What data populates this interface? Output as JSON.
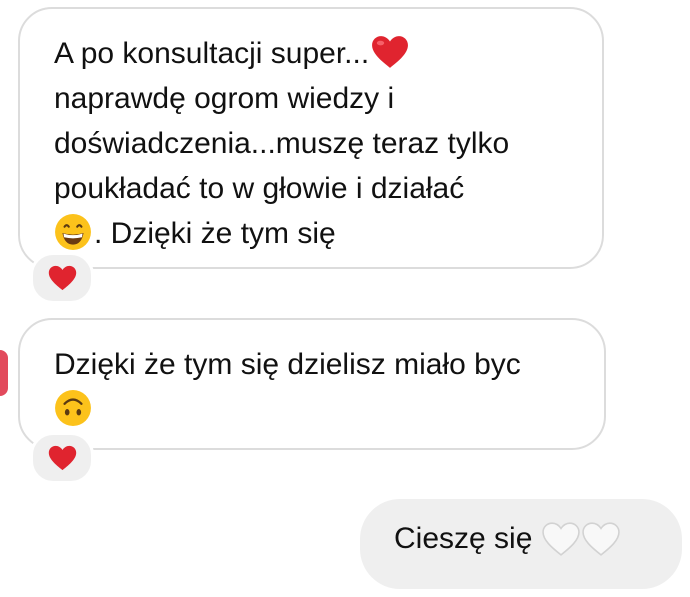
{
  "messages": [
    {
      "direction": "incoming",
      "lines": [
        "A po konsultacji super...",
        "naprawdę ogrom wiedzy i",
        "doświadczenia...muszę teraz tylko",
        "poukładać to w głowie i działać",
        ". Dzięki że tym się"
      ],
      "emojis": [
        "red-heart",
        "grinning-face"
      ],
      "reaction": "red-heart"
    },
    {
      "direction": "incoming",
      "lines": [
        "Dzięki że tym się dzielisz miało byc"
      ],
      "emojis": [
        "upside-down-face"
      ],
      "reaction": "red-heart"
    },
    {
      "direction": "outgoing",
      "text": "Cieszę się",
      "emojis": [
        "white-heart",
        "white-heart"
      ]
    }
  ],
  "colors": {
    "incoming_bubble_bg": "#ffffff",
    "incoming_bubble_border": "#dcdcdc",
    "outgoing_bubble_bg": "#efefef",
    "reaction_bg": "#efefef",
    "heart_red": "#e0242f",
    "edge_mark": "#e24a5c"
  }
}
